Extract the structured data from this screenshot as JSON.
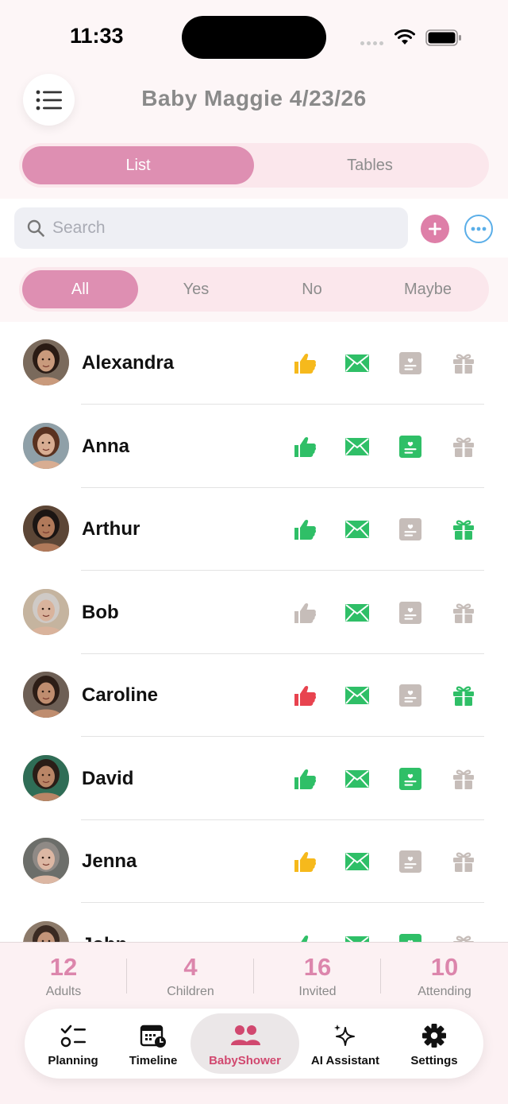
{
  "status_bar": {
    "time": "11:33"
  },
  "header": {
    "title": "Baby Maggie 4/23/26"
  },
  "view_switch": {
    "tabs": [
      "List",
      "Tables"
    ],
    "active": "List"
  },
  "search": {
    "placeholder": "Search",
    "value": ""
  },
  "filter": {
    "options": [
      "All",
      "Yes",
      "No",
      "Maybe"
    ],
    "active": "All"
  },
  "colors": {
    "accent_pink": "#de8fb2",
    "green": "#2fbf67",
    "yellow": "#f6b91c",
    "red": "#e8434f",
    "gray": "#c6bdb9",
    "blue": "#5aaee8"
  },
  "guests": [
    {
      "name": "Alexandra",
      "rsvp": "maybe",
      "invite_sent": true,
      "card": false,
      "gift": false
    },
    {
      "name": "Anna",
      "rsvp": "yes",
      "invite_sent": true,
      "card": true,
      "gift": false
    },
    {
      "name": "Arthur",
      "rsvp": "yes",
      "invite_sent": true,
      "card": false,
      "gift": true
    },
    {
      "name": "Bob",
      "rsvp": "none",
      "invite_sent": true,
      "card": false,
      "gift": false
    },
    {
      "name": "Caroline",
      "rsvp": "no",
      "invite_sent": true,
      "card": false,
      "gift": true
    },
    {
      "name": "David",
      "rsvp": "yes",
      "invite_sent": true,
      "card": true,
      "gift": false
    },
    {
      "name": "Jenna",
      "rsvp": "maybe",
      "invite_sent": true,
      "card": false,
      "gift": false
    },
    {
      "name": "John",
      "rsvp": "yes",
      "invite_sent": true,
      "card": true,
      "gift": false
    }
  ],
  "stats": [
    {
      "value": "12",
      "label": "Adults"
    },
    {
      "value": "4",
      "label": "Children"
    },
    {
      "value": "16",
      "label": "Invited"
    },
    {
      "value": "10",
      "label": "Attending"
    }
  ],
  "tab_bar": {
    "tabs": [
      {
        "label": "Planning",
        "icon": "checklist-icon"
      },
      {
        "label": "Timeline",
        "icon": "calendar-clock-icon"
      },
      {
        "label": "BabyShower",
        "icon": "people-icon"
      },
      {
        "label": "AI Assistant",
        "icon": "sparkles-icon"
      },
      {
        "label": "Settings",
        "icon": "gear-icon"
      }
    ],
    "active": "BabyShower"
  }
}
